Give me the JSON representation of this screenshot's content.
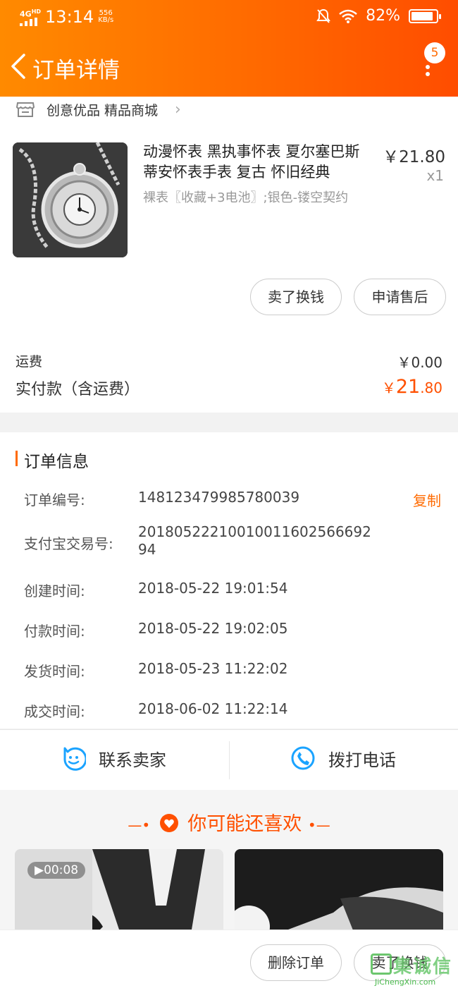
{
  "status_bar": {
    "network": "4G",
    "network_sup": "HD",
    "time": "13:14",
    "speed_value": "556",
    "speed_unit": "KB/s",
    "battery": "82%"
  },
  "nav": {
    "title": "订单详情",
    "notification_count": "5"
  },
  "shop": {
    "name": "创意优品 精品商城"
  },
  "product": {
    "name": "动漫怀表 黑执事怀表 夏尔塞巴斯蒂安怀表手表 复古 怀旧经典",
    "sku": "裸表〖收藏+3电池〗;银色-镂空契约",
    "price": "￥21.80",
    "quantity": "x1"
  },
  "item_actions": {
    "sell": "卖了换钱",
    "after_sale": "申请售后"
  },
  "totals": {
    "shipping_label": "运费",
    "shipping_value": "￥0.00",
    "paid_label": "实付款（含运费）",
    "paid_currency": "￥",
    "paid_int": "21",
    "paid_dec": ".80"
  },
  "order_info": {
    "title": "订单信息",
    "copy_label": "复制",
    "rows": [
      {
        "label": "订单编号:",
        "value": "148123479985780039"
      },
      {
        "label": "支付宝交易号:",
        "value": "20180522210010011602566692 94"
      },
      {
        "label": "创建时间:",
        "value": "2018-05-22 19:01:54"
      },
      {
        "label": "付款时间:",
        "value": "2018-05-22 19:02:05"
      },
      {
        "label": "发货时间:",
        "value": "2018-05-23 11:22:02"
      },
      {
        "label": "成交时间:",
        "value": "2018-06-02 11:22:14"
      }
    ]
  },
  "contact": {
    "seller": "联系卖家",
    "call": "拨打电话"
  },
  "recommend": {
    "title": "你可能还喜欢",
    "video_duration": "00:08"
  },
  "bottom_bar": {
    "delete": "删除订单",
    "sell": "卖了换钱"
  },
  "watermark": {
    "text": "集诚信",
    "url": "JiChengXin.com"
  },
  "colors": {
    "accent": "#ff6a00",
    "price": "#ff5000",
    "contact_icon": "#1aa3ff"
  }
}
